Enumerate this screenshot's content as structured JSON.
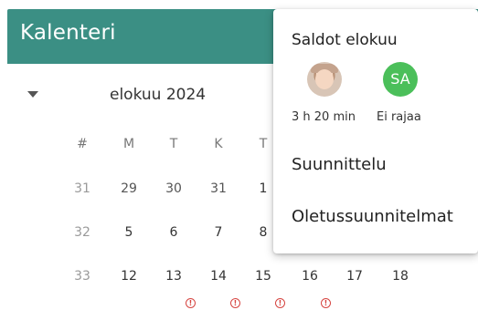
{
  "appbar": {
    "title": "Kalenteri",
    "color": "#3b8f84"
  },
  "calendar": {
    "month_label": "elokuu 2024",
    "headers": [
      "#",
      "M",
      "T",
      "K",
      "T"
    ],
    "rows": [
      {
        "week": "31",
        "days": [
          "29",
          "30",
          "31",
          "1"
        ]
      },
      {
        "week": "32",
        "days": [
          "5",
          "6",
          "7",
          "8"
        ]
      },
      {
        "week": "33",
        "days": [
          "12",
          "13",
          "14",
          "15",
          "16",
          "17",
          "18"
        ]
      }
    ],
    "warning_color": "#d64541",
    "warning_days": [
      "13",
      "14",
      "15",
      "16"
    ]
  },
  "menu": {
    "header": "Saldot elokuu",
    "summary": {
      "time": "3 h 20 min",
      "limit": "Ei rajaa",
      "initials": "SA",
      "initials_color": "#4bbf5a"
    },
    "items": [
      "Suunnittelu",
      "Oletussuunnitelmat"
    ]
  }
}
